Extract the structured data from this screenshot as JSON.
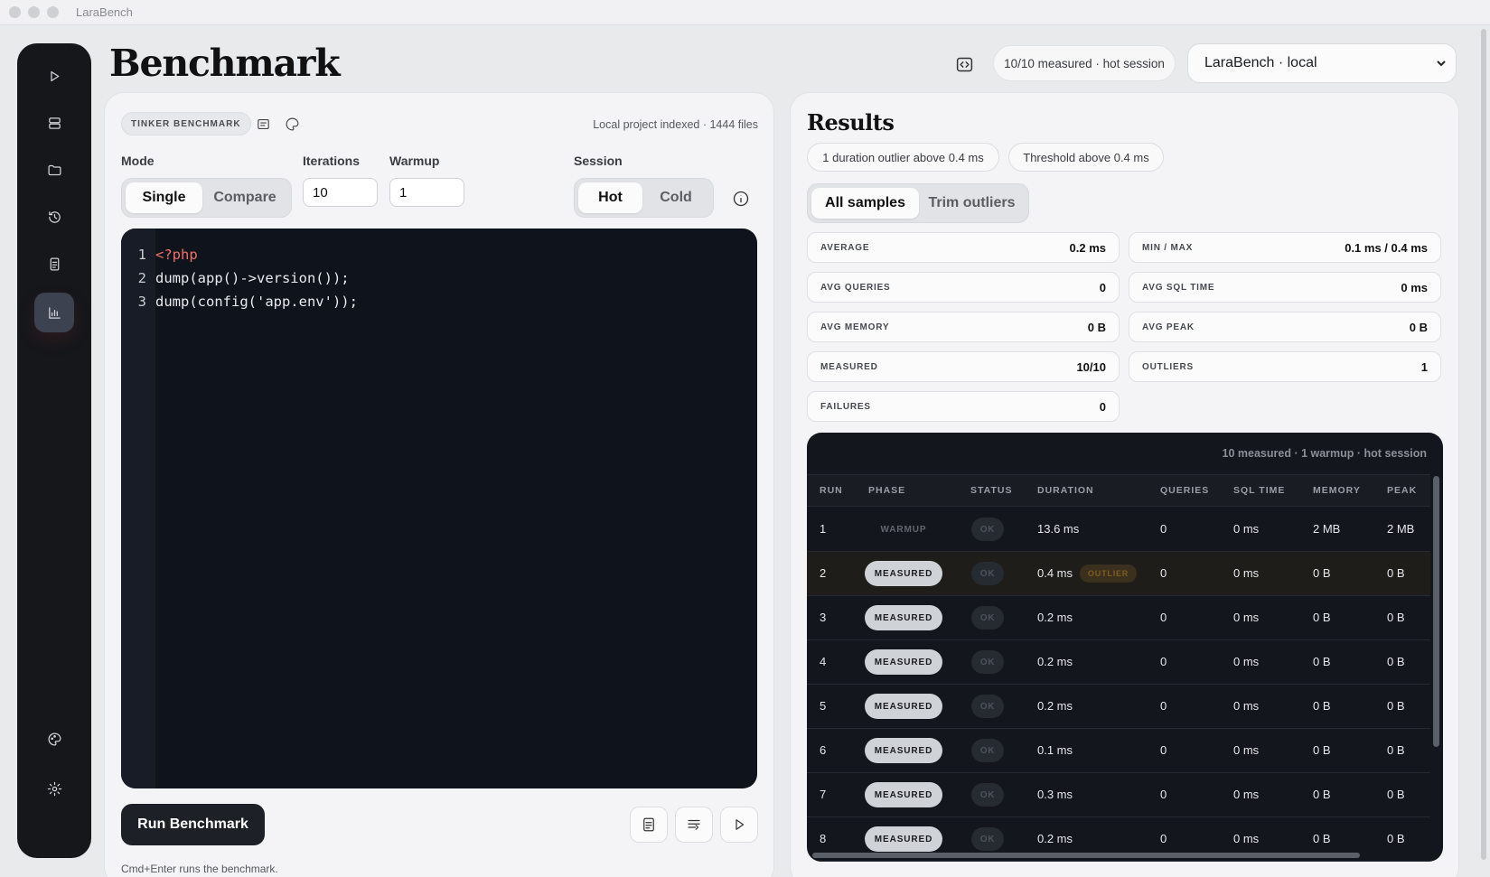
{
  "window": {
    "title": "LaraBench"
  },
  "header": {
    "page_title": "Benchmark",
    "status_pill": "10/10 measured · hot session",
    "project_select": "LaraBench · local"
  },
  "benchmark": {
    "badge": "TINKER BENCHMARK",
    "indexed": "Local project indexed · 1444 files",
    "mode_label": "Mode",
    "mode_options": [
      "Single",
      "Compare"
    ],
    "mode_selected": "Single",
    "iterations_label": "Iterations",
    "iterations_value": "10",
    "warmup_label": "Warmup",
    "warmup_value": "1",
    "session_label": "Session",
    "session_options": [
      "Hot",
      "Cold"
    ],
    "session_selected": "Hot",
    "run_label": "Run Benchmark",
    "hint": "Cmd+Enter runs the benchmark."
  },
  "editor": {
    "lines": [
      {
        "num": "1",
        "text": "<?php"
      },
      {
        "num": "2",
        "text": "dump(app()->version());"
      },
      {
        "num": "3",
        "text": "dump(config('app.env'));"
      }
    ]
  },
  "results": {
    "title": "Results",
    "chips": [
      "1 duration outlier above 0.4 ms",
      "Threshold above 0.4 ms"
    ],
    "filter_options": [
      "All samples",
      "Trim outliers"
    ],
    "filter_selected": "All samples",
    "stats": [
      {
        "key": "AVERAGE",
        "value": "0.2 ms"
      },
      {
        "key": "MIN / MAX",
        "value": "0.1 ms / 0.4 ms"
      },
      {
        "key": "AVG QUERIES",
        "value": "0"
      },
      {
        "key": "AVG SQL TIME",
        "value": "0 ms"
      },
      {
        "key": "AVG MEMORY",
        "value": "0 B"
      },
      {
        "key": "AVG PEAK",
        "value": "0 B"
      },
      {
        "key": "MEASURED",
        "value": "10/10"
      },
      {
        "key": "OUTLIERS",
        "value": "1"
      },
      {
        "key": "FAILURES",
        "value": "0"
      }
    ],
    "table_summary": "10 measured · 1 warmup · hot session",
    "columns": [
      "RUN",
      "PHASE",
      "STATUS",
      "DURATION",
      "QUERIES",
      "SQL TIME",
      "MEMORY",
      "PEAK"
    ],
    "outlier_label": "OUTLIER",
    "rows": [
      {
        "run": "1",
        "phase": "WARMUP",
        "status": "OK",
        "duration": "13.6 ms",
        "queries": "0",
        "sql": "0 ms",
        "memory": "2 MB",
        "peak": "2 MB"
      },
      {
        "run": "2",
        "phase": "MEASURED",
        "status": "OK",
        "duration": "0.4 ms",
        "queries": "0",
        "sql": "0 ms",
        "memory": "0 B",
        "peak": "0 B",
        "outlier": true
      },
      {
        "run": "3",
        "phase": "MEASURED",
        "status": "OK",
        "duration": "0.2 ms",
        "queries": "0",
        "sql": "0 ms",
        "memory": "0 B",
        "peak": "0 B"
      },
      {
        "run": "4",
        "phase": "MEASURED",
        "status": "OK",
        "duration": "0.2 ms",
        "queries": "0",
        "sql": "0 ms",
        "memory": "0 B",
        "peak": "0 B"
      },
      {
        "run": "5",
        "phase": "MEASURED",
        "status": "OK",
        "duration": "0.2 ms",
        "queries": "0",
        "sql": "0 ms",
        "memory": "0 B",
        "peak": "0 B"
      },
      {
        "run": "6",
        "phase": "MEASURED",
        "status": "OK",
        "duration": "0.1 ms",
        "queries": "0",
        "sql": "0 ms",
        "memory": "0 B",
        "peak": "0 B"
      },
      {
        "run": "7",
        "phase": "MEASURED",
        "status": "OK",
        "duration": "0.3 ms",
        "queries": "0",
        "sql": "0 ms",
        "memory": "0 B",
        "peak": "0 B"
      },
      {
        "run": "8",
        "phase": "MEASURED",
        "status": "OK",
        "duration": "0.2 ms",
        "queries": "0",
        "sql": "0 ms",
        "memory": "0 B",
        "peak": "0 B"
      }
    ]
  },
  "icons": {
    "sidebar": [
      "play-icon",
      "database-icon",
      "folder-icon",
      "history-icon",
      "document-icon",
      "chart-icon",
      "palette-icon",
      "gear-icon"
    ],
    "toolbar": [
      "notes-icon",
      "format-icon",
      "play-icon"
    ]
  },
  "colors": {
    "editor_bg": "#0f131c",
    "sidebar_bg": "#15171b",
    "accent_warn": "#7d5d22",
    "keyword": "#f07167",
    "string": "#e5c07b"
  }
}
